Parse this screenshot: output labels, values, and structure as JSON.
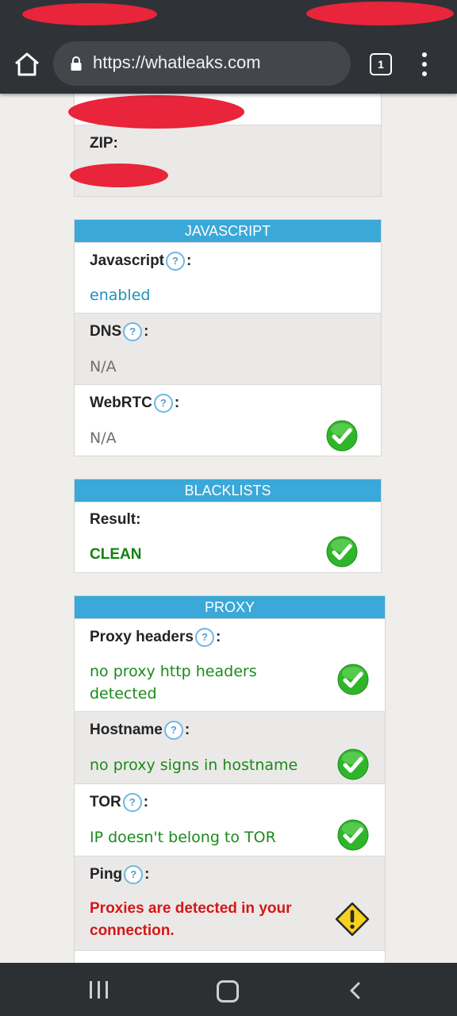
{
  "browser": {
    "url": "https://whatleaks.com",
    "tab_count": "1"
  },
  "location_card": {
    "zip_label": "ZIP:"
  },
  "javascript_card": {
    "title": "JAVASCRIPT",
    "rows": [
      {
        "label": "Javascript",
        "value": "enabled",
        "status": null
      },
      {
        "label": "DNS",
        "value": "N/A",
        "status": null
      },
      {
        "label": "WebRTC",
        "value": "N/A",
        "status": "check"
      }
    ]
  },
  "blacklists_card": {
    "title": "BLACKLISTS",
    "result_label": "Result:",
    "result_value": "CLEAN",
    "status": "check"
  },
  "proxy_card": {
    "title": "PROXY",
    "rows": [
      {
        "label": "Proxy headers",
        "value_line1": "no proxy http headers",
        "value_line2": "detected",
        "status": "check"
      },
      {
        "label": "Hostname",
        "value": "no proxy signs in hostname",
        "status": "check"
      },
      {
        "label": "TOR",
        "value": "IP doesn't belong to TOR",
        "status": "check"
      },
      {
        "label": "Ping",
        "value_line1": "Proxies are detected in your",
        "value_line2": "connection.",
        "status": "warning"
      }
    ]
  },
  "help_glyph": "?",
  "colors": {
    "header_blue": "#3aa8d8",
    "check_green": "#2fb52a",
    "warning_yellow": "#f7d11e",
    "alert_red": "#d51616"
  },
  "icons": [
    "home-icon",
    "lock-icon",
    "tab-switcher-icon",
    "more-vert-icon",
    "help-icon",
    "check-icon",
    "warning-icon",
    "recents-icon",
    "nav-home-icon",
    "back-icon"
  ]
}
